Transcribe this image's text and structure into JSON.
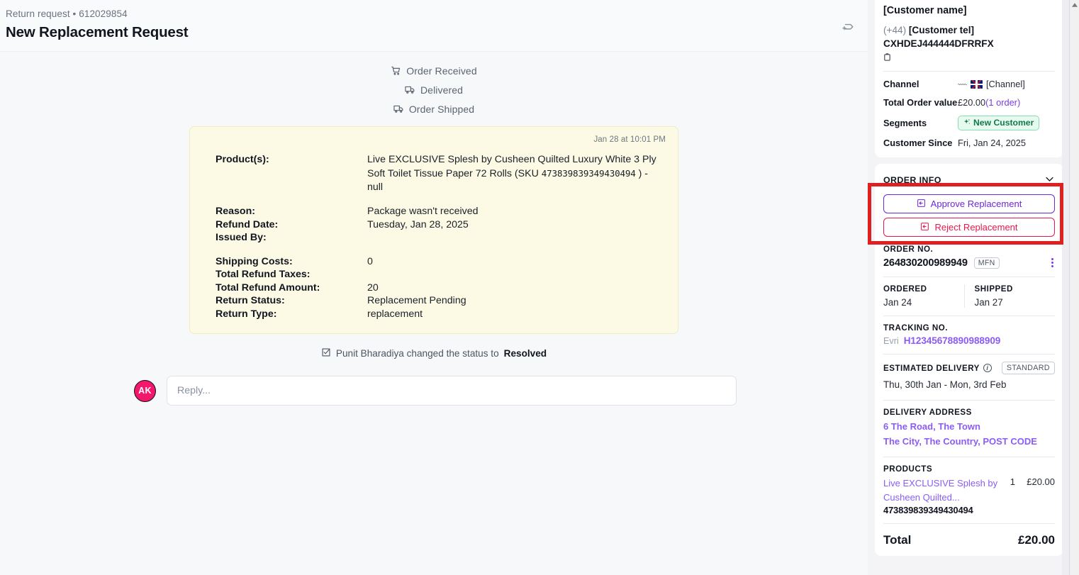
{
  "header": {
    "breadcrumb": "Return request • 612029854",
    "title": "New Replacement Request",
    "action_icon": "forward-plus-icon"
  },
  "timeline": [
    {
      "label": "Order Received",
      "icon": "shopping-cart-icon"
    },
    {
      "label": "Delivered",
      "icon": "truck-icon"
    },
    {
      "label": "Order Shipped",
      "icon": "truck-icon"
    }
  ],
  "note": {
    "timestamp": "Jan 28 at 10:01 PM",
    "product_label": "Product(s):",
    "product_prefix": "Live EXCLUSIVE Splesh by Cusheen Quilted Luxury White 3 Ply Soft Toilet Tissue Paper 72 Rolls (SKU ",
    "product_sku": "473839839349430494",
    "product_suffix": " ) - null",
    "rows": [
      {
        "label": "Reason:",
        "value": "Package wasn't received"
      },
      {
        "label": "Refund Date:",
        "value": "Tuesday, Jan 28, 2025"
      },
      {
        "label": "Issued By:",
        "value": ""
      }
    ],
    "rows2": [
      {
        "label": "Shipping Costs:",
        "value": "0"
      },
      {
        "label": "Total Refund Taxes:",
        "value": ""
      },
      {
        "label": "Total Refund Amount:",
        "value": "20"
      },
      {
        "label": "Return Status:",
        "value": "Replacement Pending"
      },
      {
        "label": "Return Type:",
        "value": "replacement"
      }
    ]
  },
  "status_change": {
    "icon": "checkbox-checked-icon",
    "text": "Punit Bharadiya changed the status to ",
    "status": "Resolved"
  },
  "reply": {
    "avatar_initials": "AK",
    "placeholder": "Reply..."
  },
  "customer": {
    "name": "[Customer name]",
    "country_code": "(+44)",
    "tel": "[Customer tel]",
    "id": "CXHDEJ444444DFRRFX",
    "copy_icon": "copy-icon",
    "fields": [
      {
        "key": "Channel",
        "value": "[Channel]"
      },
      {
        "key": "Total Order value",
        "value": "£20.00",
        "link": "(1 order)"
      },
      {
        "key": "Segments",
        "badge": "New Customer"
      },
      {
        "key": "Customer Since",
        "value": "Fri, Jan 24, 2025"
      }
    ]
  },
  "order_info": {
    "section_title": "ORDER INFO",
    "collapse_icon": "chevron-down-icon",
    "approve_label": "Approve Replacement",
    "reject_label": "Reject Replacement",
    "approve_icon": "arrow-into-box-icon",
    "reject_icon": "arrow-into-box-icon",
    "order_no_label": "ORDER NO.",
    "order_no": "264830200989949",
    "fulfillment_chip": "MFN",
    "kebab_icon": "more-vertical-icon",
    "ordered_label": "ORDERED",
    "ordered_value": "Jan 24",
    "shipped_label": "SHIPPED",
    "shipped_value": "Jan 27",
    "tracking_label": "TRACKING NO.",
    "carrier": "Evri",
    "tracking_no": "H12345678890988909",
    "eta_label": "ESTIMATED DELIVERY",
    "eta_info_icon": "info-icon",
    "eta_chip": "STANDARD",
    "eta_value": "Thu, 30th Jan - Mon, 3rd Feb",
    "address_label": "DELIVERY ADDRESS",
    "address_line1": "6 The Road, The Town",
    "address_line2": "The City, The Country, POST CODE",
    "products_label": "PRODUCTS",
    "product_name": "Live EXCLUSIVE Splesh by Cusheen Quilted...",
    "product_qty": "1",
    "product_price": "£20.00",
    "product_sku": "473839839349430494",
    "total_label": "Total",
    "total_value": "£20.00"
  },
  "colors": {
    "accent_purple": "#7c3aed",
    "reject_red": "#e8174e",
    "annotation_red": "#e02020",
    "note_yellow": "#fcfae4",
    "avatar_pink": "#f4186c",
    "badge_green": "#14794a"
  }
}
